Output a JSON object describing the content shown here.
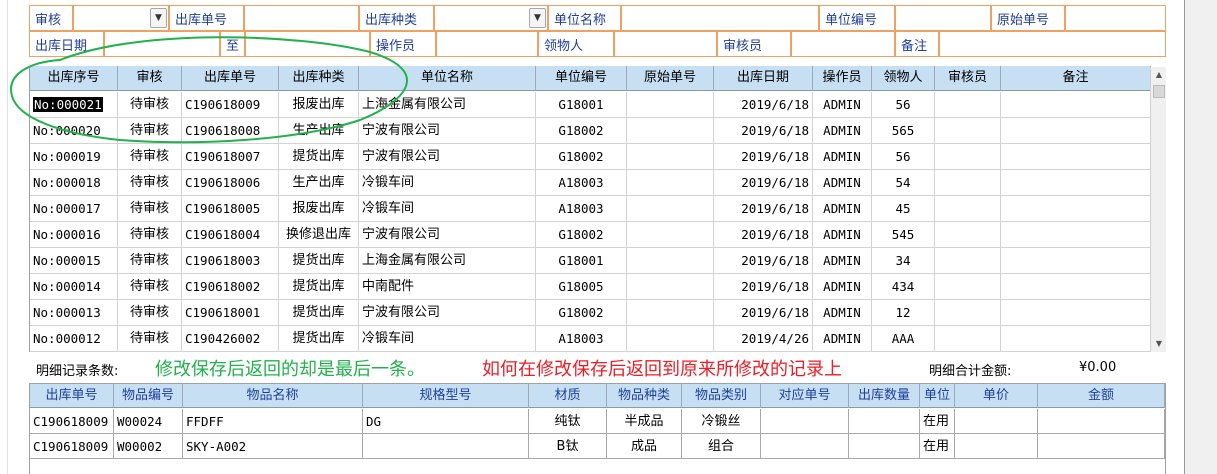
{
  "filters": {
    "row1": [
      {
        "label": "审核",
        "value": ""
      },
      {
        "label": "出库单号",
        "value": ""
      },
      {
        "label": "出库种类",
        "value": ""
      },
      {
        "label": "单位名称",
        "value": ""
      },
      {
        "label": "单位编号",
        "value": ""
      },
      {
        "label": "原始单号",
        "value": ""
      }
    ],
    "row2": [
      {
        "label": "出库日期",
        "value": ""
      },
      {
        "label": "至",
        "value": ""
      },
      {
        "label": "操作员",
        "value": ""
      },
      {
        "label": "领物人",
        "value": ""
      },
      {
        "label": "审核员",
        "value": ""
      },
      {
        "label": "备注",
        "value": ""
      }
    ]
  },
  "master": {
    "columns": [
      "出库序号",
      "审核",
      "出库单号",
      "出库种类",
      "单位名称",
      "单位编号",
      "原始单号",
      "出库日期",
      "操作员",
      "领物人",
      "审核员",
      "备注"
    ],
    "rows": [
      [
        "No:000021",
        "待审核",
        "C190618009",
        "报废出库",
        "上海金属有限公司",
        "G18001",
        "",
        "2019/6/18",
        "ADMIN",
        "56",
        "",
        ""
      ],
      [
        "No:000020",
        "待审核",
        "C190618008",
        "生产出库",
        "宁波有限公司",
        "G18002",
        "",
        "2019/6/18",
        "ADMIN",
        "565",
        "",
        ""
      ],
      [
        "No:000019",
        "待审核",
        "C190618007",
        "提货出库",
        "宁波有限公司",
        "G18002",
        "",
        "2019/6/18",
        "ADMIN",
        "56",
        "",
        ""
      ],
      [
        "No:000018",
        "待审核",
        "C190618006",
        "生产出库",
        "冷锻车间",
        "A18003",
        "",
        "2019/6/18",
        "ADMIN",
        "54",
        "",
        ""
      ],
      [
        "No:000017",
        "待审核",
        "C190618005",
        "报废出库",
        "冷锻车间",
        "A18003",
        "",
        "2019/6/18",
        "ADMIN",
        "45",
        "",
        ""
      ],
      [
        "No:000016",
        "待审核",
        "C190618004",
        "换修退出库",
        "宁波有限公司",
        "G18002",
        "",
        "2019/6/18",
        "ADMIN",
        "545",
        "",
        ""
      ],
      [
        "No:000015",
        "待审核",
        "C190618003",
        "提货出库",
        "上海金属有限公司",
        "G18001",
        "",
        "2019/6/18",
        "ADMIN",
        "34",
        "",
        ""
      ],
      [
        "No:000014",
        "待审核",
        "C190618002",
        "提货出库",
        "中南配件",
        "G18005",
        "",
        "2019/6/18",
        "ADMIN",
        "434",
        "",
        ""
      ],
      [
        "No:000013",
        "待审核",
        "C190618001",
        "提货出库",
        "宁波有限公司",
        "G18002",
        "",
        "2019/6/18",
        "ADMIN",
        "12",
        "",
        ""
      ],
      [
        "No:000012",
        "待审核",
        "C190426002",
        "提货出库",
        "冷锻车间",
        "A18003",
        "",
        "2019/4/26",
        "ADMIN",
        "AAA",
        "",
        ""
      ]
    ]
  },
  "summary": {
    "detail_count_label": "明细记录条数:",
    "note_green": "修改保存后返回的却是最后一条。",
    "note_red": "如何在修改保存后返回到原来所修改的记录上",
    "total_label": "明细合计金额:",
    "total_value": "¥0.00"
  },
  "detail": {
    "columns": [
      "出库单号",
      "物品编号",
      "物品名称",
      "规格型号",
      "材质",
      "物品种类",
      "物品类别",
      "对应单号",
      "出库数量",
      "单位",
      "单价",
      "金额"
    ],
    "rows": [
      [
        "C190618009",
        "W00024",
        "FFDFF",
        "DG",
        "纯钛",
        "半成品",
        "冷锻丝",
        "",
        "",
        "在用",
        "",
        ""
      ],
      [
        "C190618009",
        "W00002",
        "SKY-A002",
        "",
        "B钛",
        "成品",
        "组合",
        "",
        "",
        "在用",
        "",
        ""
      ]
    ]
  },
  "colors": {
    "header_bg": "#c7dff2",
    "label_blue": "#1f3e9c",
    "form_border": "#f0a060",
    "annotation_green": "#22b14c",
    "annotation_red": "#ec1c24"
  }
}
